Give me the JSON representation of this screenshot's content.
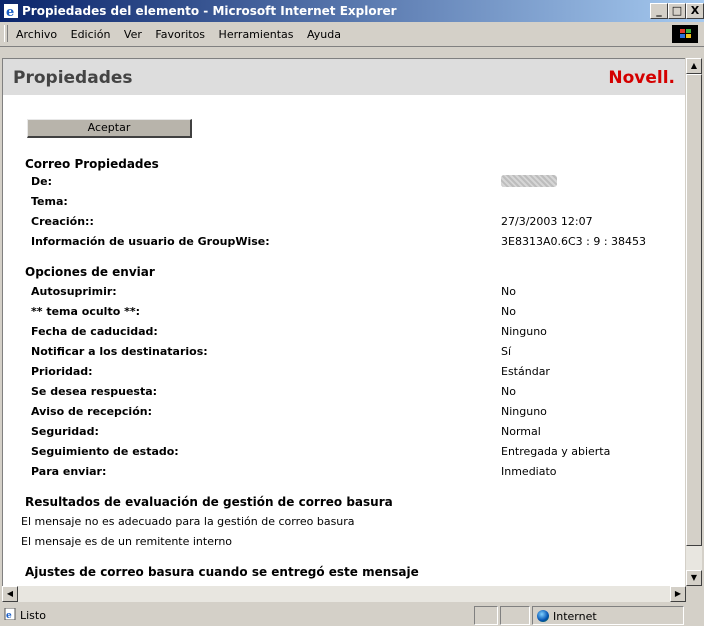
{
  "window": {
    "title": "Propiedades del elemento - Microsoft Internet Explorer",
    "minimize": "_",
    "maximize": "□",
    "close": "X"
  },
  "menu": [
    "Archivo",
    "Edición",
    "Ver",
    "Favoritos",
    "Herramientas",
    "Ayuda"
  ],
  "page": {
    "title": "Propiedades",
    "logo": "Novell.",
    "accept_label": "Aceptar"
  },
  "correo": {
    "heading": "Correo  Propiedades",
    "rows": [
      {
        "label": "De:",
        "value": ""
      },
      {
        "label": "Tema:",
        "value": ""
      },
      {
        "label": "Creación::",
        "value": "27/3/2003 12:07"
      },
      {
        "label": "Información de usuario de GroupWise:",
        "value": "3E8313A0.6C3 : 9 : 38453"
      }
    ]
  },
  "opciones": {
    "heading": "Opciones de enviar",
    "rows": [
      {
        "label": "Autosuprimir:",
        "value": "No"
      },
      {
        "label": "** tema oculto **:",
        "value": "No"
      },
      {
        "label": "Fecha de caducidad:",
        "value": "Ninguno"
      },
      {
        "label": "Notificar a los destinatarios:",
        "value": "Sí"
      },
      {
        "label": "Prioridad:",
        "value": "Estándar"
      },
      {
        "label": "Se desea respuesta:",
        "value": "No"
      },
      {
        "label": "Aviso de recepción:",
        "value": "Ninguno"
      },
      {
        "label": "Seguridad:",
        "value": "Normal"
      },
      {
        "label": "Seguimiento de estado:",
        "value": "Entregada y abierta"
      },
      {
        "label": "Para enviar:",
        "value": "Inmediato"
      }
    ]
  },
  "basura": {
    "heading": "Resultados de evaluación de gestión de correo basura",
    "lines": [
      "El mensaje no es adecuado para la gestión de correo basura",
      "El mensaje es de un remitente interno"
    ]
  },
  "ajustes": {
    "heading": "Ajustes de correo basura cuando se entregó este mensaje"
  },
  "status": {
    "text": "Listo",
    "zone": "Internet"
  }
}
